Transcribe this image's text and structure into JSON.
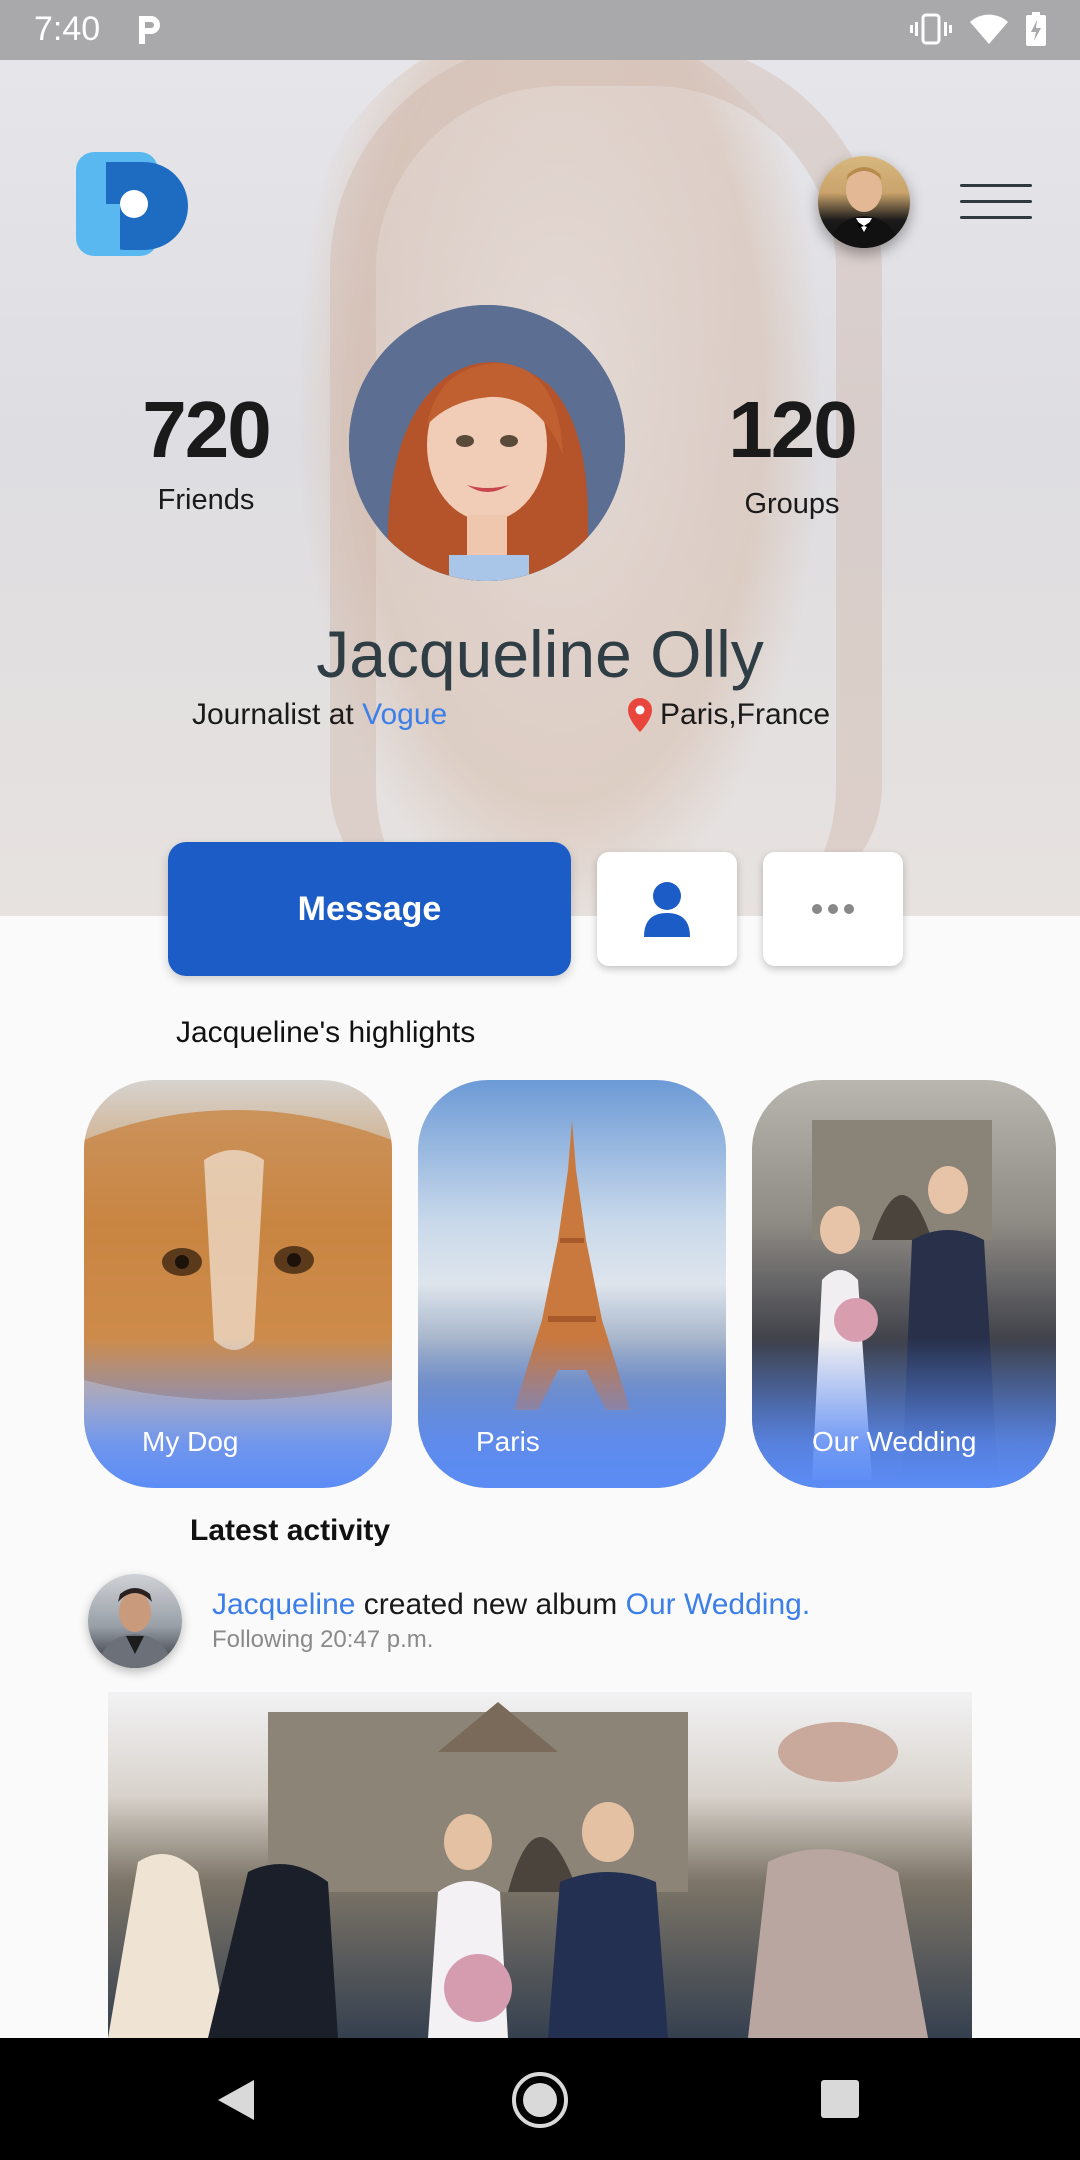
{
  "status_bar": {
    "time": "7:40"
  },
  "profile": {
    "name": "Jacqueline Olly",
    "job_prefix": "Journalist at",
    "employer": "Vogue",
    "location": "Paris,France"
  },
  "stats": {
    "friends": {
      "value": "720",
      "label": "Friends"
    },
    "groups": {
      "value": "120",
      "label": "Groups"
    }
  },
  "actions": {
    "message_label": "Message"
  },
  "highlights": {
    "title": "Jacqueline's highlights",
    "items": [
      {
        "label": "My Dog"
      },
      {
        "label": "Paris"
      },
      {
        "label": "Our Wedding"
      }
    ]
  },
  "activity": {
    "title": "Latest activity",
    "actor": "Jacqueline",
    "action": "created new album",
    "album": "Our Wedding.",
    "meta_status": "Following",
    "meta_time": "20:47 p.m."
  },
  "colors": {
    "primary": "#1b5cc6",
    "link": "#3d7fe8",
    "highlight_overlay": "#5b8cf5",
    "location_pin": "#e8453c"
  }
}
